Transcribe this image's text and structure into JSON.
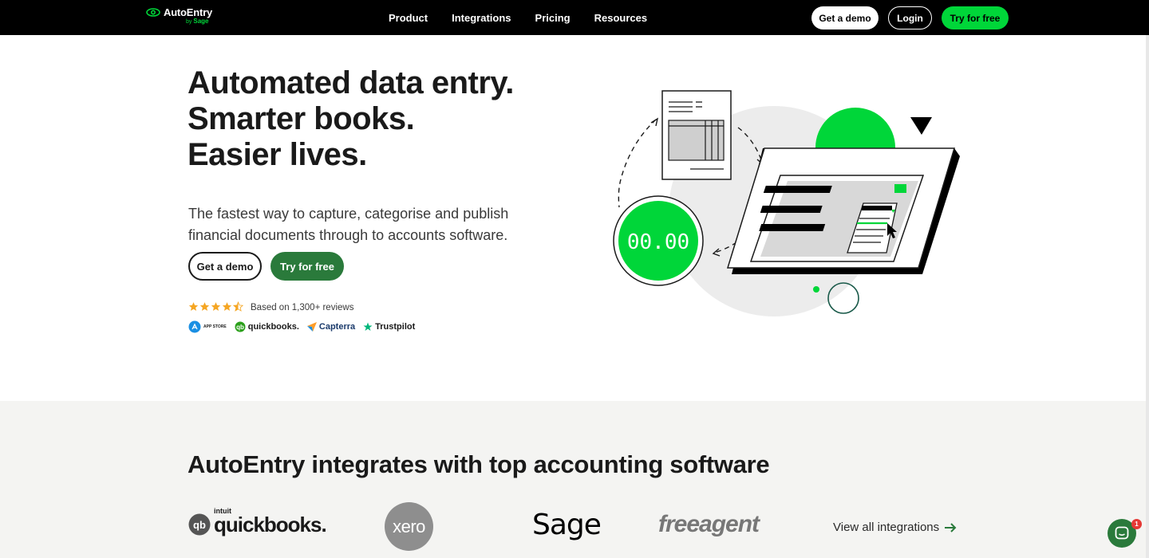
{
  "nav": {
    "logo": "AutoEntry",
    "logo_by": "by",
    "logo_brand": "Sage",
    "links": [
      "Product",
      "Integrations",
      "Pricing",
      "Resources"
    ],
    "demo_label": "Get a demo",
    "login_label": "Login",
    "try_label": "Try for free"
  },
  "hero": {
    "headline": [
      "Automated data entry.",
      "Smarter books.",
      "Easier lives."
    ],
    "subtitle": "The fastest way to capture, categorise and publish financial documents through to accounts software.",
    "demo_label": "Get a demo",
    "try_label": "Try for free",
    "rating": 4.5,
    "reviews_text": "Based on 1,300+ reviews",
    "badges": {
      "appstore": "APP STORE",
      "quickbooks": "quickbooks.",
      "quickbooks_intuit": "intuit",
      "capterra": "Capterra",
      "trustpilot": "Trustpilot"
    }
  },
  "illustration": {
    "counter": "00.00"
  },
  "integrations": {
    "title": "AutoEntry integrates with top accounting software",
    "logos": {
      "quickbooks": "quickbooks.",
      "quickbooks_intuit": "intuit",
      "xero": "xero",
      "sage": "Sage",
      "freeagent": "freeagent"
    },
    "view_all": "View all integrations"
  },
  "chat": {
    "badge": "1"
  },
  "colors": {
    "brand_green": "#00d639",
    "dark_green": "#2a7a3b",
    "nav_bg": "#000000",
    "section_bg": "#f4f4f2"
  }
}
